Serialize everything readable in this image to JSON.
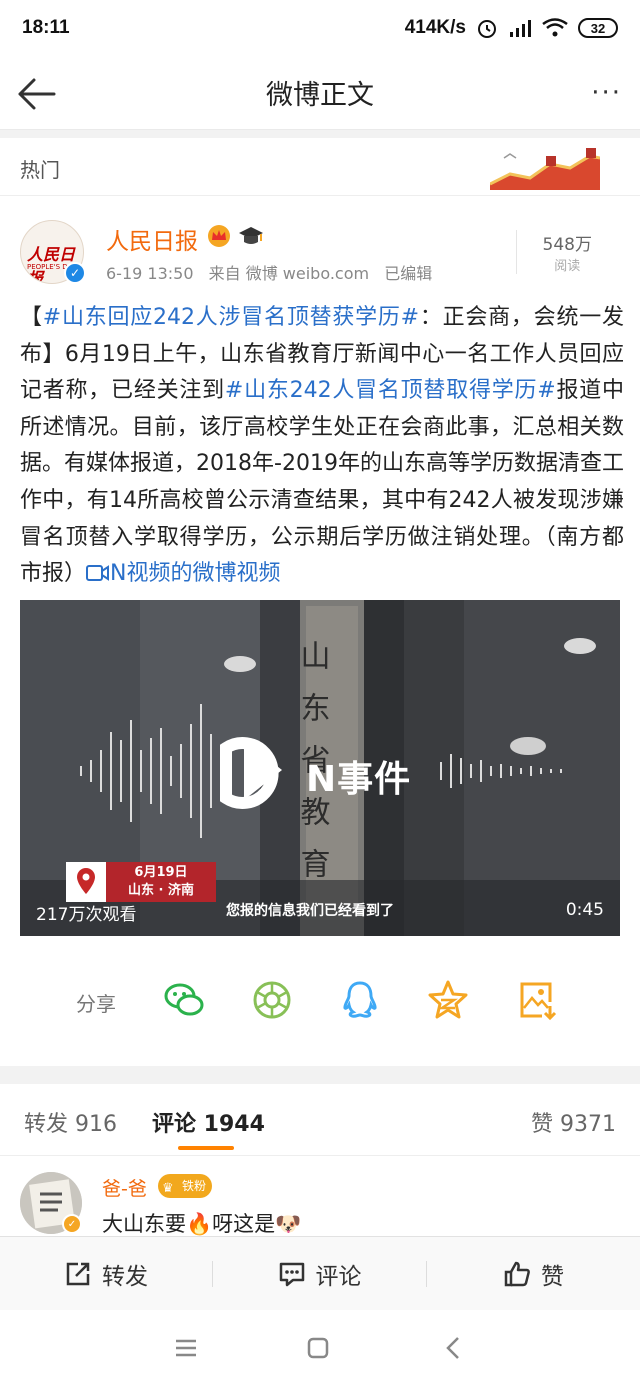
{
  "status_bar": {
    "time": "18:11",
    "net_speed": "414K/s",
    "battery": "32"
  },
  "nav": {
    "title": "微博正文",
    "more": "···"
  },
  "hot": {
    "label": "热门"
  },
  "author": {
    "avatar_logo": "人民日报",
    "avatar_logo_en": "PEOPLE'S DAILY",
    "name": "人民日报",
    "date": "6-19 13:50",
    "source": "来自 微博 weibo.com",
    "edited": "已编辑",
    "reads_count": "548万",
    "reads_label": "阅读"
  },
  "post": {
    "p1": "【",
    "tag1": "#山东回应242人涉冒名顶替获学历#",
    "p2": "：正会商，会统一发布】6月19日上午，山东省教育厅新闻中心一名工作人员回应记者称，已经关注到",
    "tag2": "#山东242人冒名顶替取得学历#",
    "p3": "报道中所述情况。目前，该厅高校学生处正在会商此事，汇总相关数据。有媒体报道，2018年-2019年的山东高等学历数据清查工作中，有14所高校曾公示清查结果，其中有242人被发现涉嫌冒名顶替入学取得学历，公示期后学历做注销处理。（南方都市报）",
    "video_link": "N视频的微博视频"
  },
  "video": {
    "logo_text": "N事件",
    "loc_date": "6月19日",
    "loc_place": "山东 · 济南",
    "views": "217万次观看",
    "subtitle": "您报的信息我们已经看到了",
    "duration": "0:45",
    "sign_text": "山东省教育"
  },
  "share": {
    "label": "分享"
  },
  "tabs": {
    "repost": "转发 916",
    "comment": "评论 1944",
    "like": "赞 9371"
  },
  "comment": {
    "name": "爸-爸",
    "badge": "铁粉",
    "text": "大山东要🔥呀这是🐶"
  },
  "actions": {
    "repost": "转发",
    "comment": "评论",
    "like": "赞"
  },
  "colors": {
    "accent": "#ff8200",
    "link": "#2a6fc9",
    "name": "#f26a0e"
  }
}
